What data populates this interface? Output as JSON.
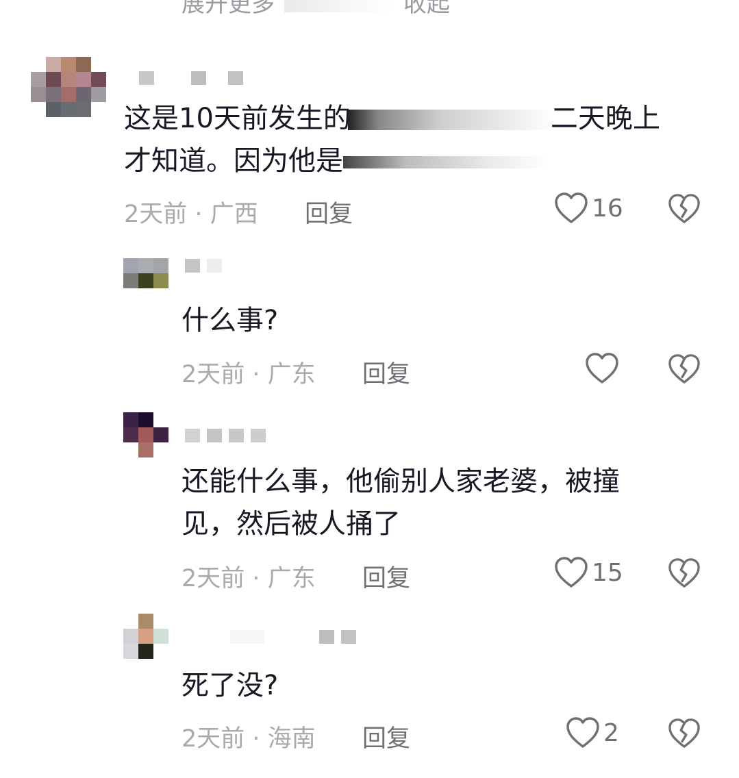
{
  "top_cut": {
    "expand": "展开更多",
    "collapse": "收起"
  },
  "comments": [
    {
      "level": 0,
      "text_a": "这是10天前发生的",
      "text_b": "二天晚上",
      "text_c": "才知道。因为他是",
      "time": "2天前",
      "sep": "·",
      "location": "广西",
      "reply_label": "回复",
      "likes": "16"
    },
    {
      "level": 1,
      "text": "什么事?",
      "time": "2天前",
      "sep": "·",
      "location": "广东",
      "reply_label": "回复",
      "likes": ""
    },
    {
      "level": 1,
      "text_a": "还能什么事，他偷别人家老婆，被撞",
      "text_b": "见，然后被人捅了",
      "time": "2天前",
      "sep": "·",
      "location": "广东",
      "reply_label": "回复",
      "likes": "15"
    },
    {
      "level": 1,
      "text": "死了没?",
      "time": "2天前",
      "sep": "·",
      "location": "海南",
      "reply_label": "回复",
      "likes": "2"
    }
  ],
  "colors": {
    "text": "#161823",
    "meta": "#a9a9ae",
    "icon": "#6f6f75"
  }
}
